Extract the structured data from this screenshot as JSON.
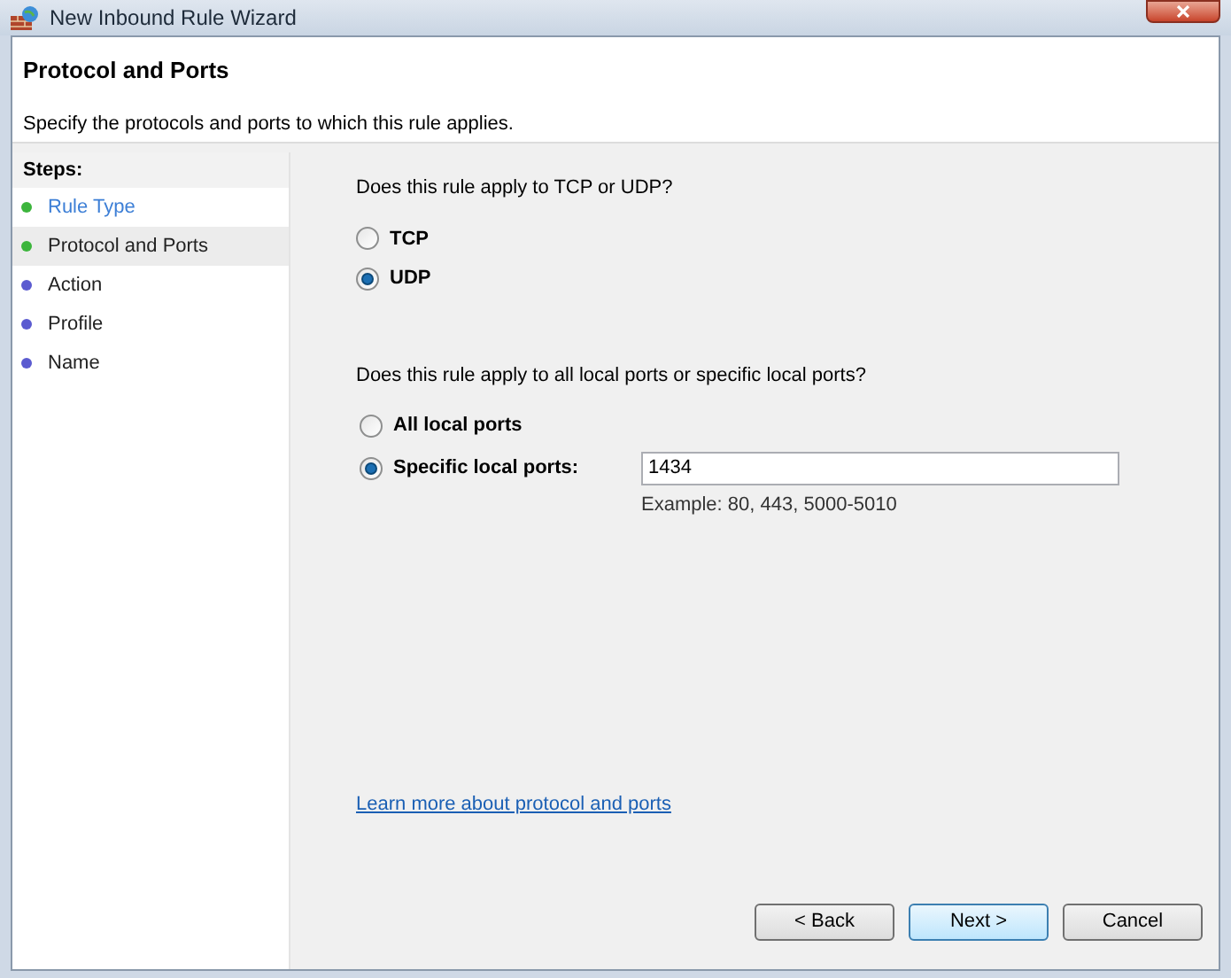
{
  "window": {
    "title": "New Inbound Rule Wizard"
  },
  "header": {
    "title": "Protocol and Ports",
    "subtitle": "Specify the protocols and ports to which this rule applies."
  },
  "steps": {
    "heading": "Steps:",
    "items": [
      {
        "label": "Rule Type",
        "color": "#3cb53c",
        "selected": false,
        "kind": "link"
      },
      {
        "label": "Protocol and Ports",
        "color": "#3cb53c",
        "selected": true,
        "kind": "plain"
      },
      {
        "label": "Action",
        "color": "#5b5bd0",
        "selected": false,
        "kind": "plain"
      },
      {
        "label": "Profile",
        "color": "#5b5bd0",
        "selected": false,
        "kind": "plain"
      },
      {
        "label": "Name",
        "color": "#5b5bd0",
        "selected": false,
        "kind": "plain"
      }
    ]
  },
  "protocol": {
    "question": "Does this rule apply to TCP or UDP?",
    "options": [
      {
        "label": "TCP",
        "selected": false
      },
      {
        "label": "UDP",
        "selected": true
      }
    ]
  },
  "ports": {
    "question": "Does this rule apply to all local ports or specific local ports?",
    "options": [
      {
        "label": "All local ports",
        "selected": false
      },
      {
        "label": "Specific local ports:",
        "selected": true,
        "value": "1434",
        "example": "Example: 80, 443, 5000-5010"
      }
    ]
  },
  "link": "Learn more about protocol and ports",
  "buttons": [
    {
      "label": "< Back",
      "default": false
    },
    {
      "label": "Next >",
      "default": true
    },
    {
      "label": "Cancel",
      "default": false
    }
  ]
}
